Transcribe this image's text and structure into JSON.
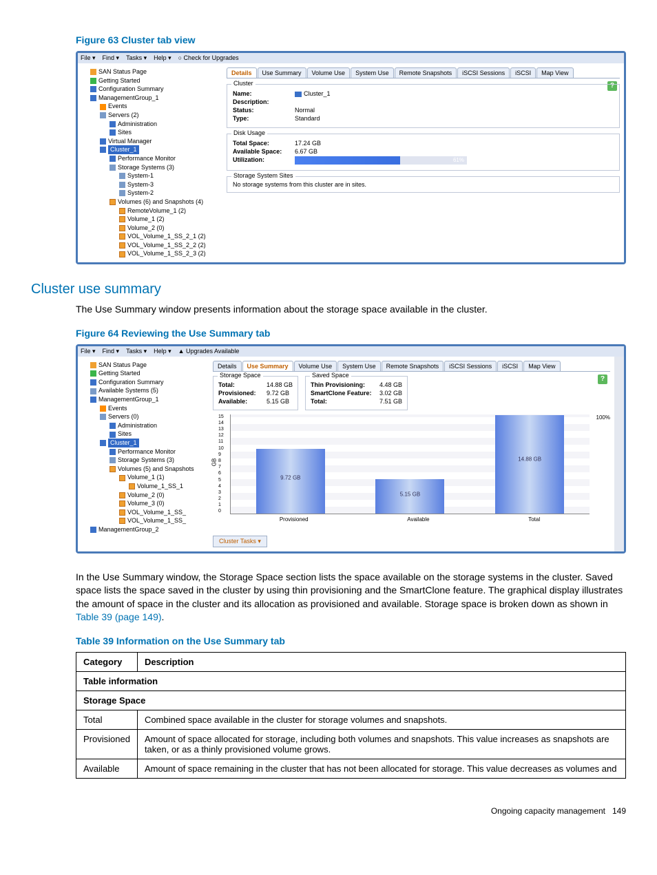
{
  "figure63": {
    "caption": "Figure 63 Cluster tab view",
    "menubar": [
      "File ▾",
      "Find ▾",
      "Tasks ▾",
      "Help ▾",
      "○ Check for Upgrades"
    ],
    "tree": [
      {
        "level": 0,
        "label": "SAN Status Page",
        "icon": "i-home"
      },
      {
        "level": 0,
        "label": "Getting Started",
        "icon": "i-green"
      },
      {
        "level": 0,
        "label": "Configuration Summary",
        "icon": "i-blue"
      },
      {
        "level": 0,
        "label": "ManagementGroup_1",
        "icon": "i-blue"
      },
      {
        "level": 1,
        "label": "Events",
        "icon": "i-orange"
      },
      {
        "level": 1,
        "label": "Servers (2)",
        "icon": "i-server"
      },
      {
        "level": 2,
        "label": "Administration",
        "icon": "i-blue"
      },
      {
        "level": 2,
        "label": "Sites",
        "icon": "i-blue"
      },
      {
        "level": 1,
        "label": "Virtual Manager",
        "icon": "i-blue"
      },
      {
        "level": 1,
        "label": "Cluster_1",
        "icon": "i-blue",
        "selected": true
      },
      {
        "level": 2,
        "label": "Performance Monitor",
        "icon": "i-blue"
      },
      {
        "level": 2,
        "label": "Storage Systems (3)",
        "icon": "i-server"
      },
      {
        "level": 3,
        "label": "System-1",
        "icon": "i-server"
      },
      {
        "level": 3,
        "label": "System-3",
        "icon": "i-server"
      },
      {
        "level": 3,
        "label": "System-2",
        "icon": "i-server"
      },
      {
        "level": 2,
        "label": "Volumes (6) and Snapshots (4)",
        "icon": "i-vol"
      },
      {
        "level": 3,
        "label": "RemoteVolume_1 (2)",
        "icon": "i-vol"
      },
      {
        "level": 3,
        "label": "Volume_1 (2)",
        "icon": "i-vol"
      },
      {
        "level": 3,
        "label": "Volume_2 (0)",
        "icon": "i-vol"
      },
      {
        "level": 3,
        "label": "VOL_Volume_1_SS_2_1 (2)",
        "icon": "i-vol"
      },
      {
        "level": 3,
        "label": "VOL_Volume_1_SS_2_2 (2)",
        "icon": "i-vol"
      },
      {
        "level": 3,
        "label": "VOL_Volume_1_SS_2_3 (2)",
        "icon": "i-vol"
      }
    ],
    "tabs": [
      "Details",
      "Use Summary",
      "Volume Use",
      "System Use",
      "Remote Snapshots",
      "iSCSI Sessions",
      "iSCSI",
      "Map View"
    ],
    "activeTab": "Details",
    "cluster": {
      "legend": "Cluster",
      "nameLabel": "Name:",
      "nameValue": "Cluster_1",
      "descLabel": "Description:",
      "descValue": "",
      "statusLabel": "Status:",
      "statusValue": "Normal",
      "typeLabel": "Type:",
      "typeValue": "Standard"
    },
    "diskUsage": {
      "legend": "Disk Usage",
      "totalLabel": "Total Space:",
      "totalValue": "17.24 GB",
      "availLabel": "Available Space:",
      "availValue": "6.67 GB",
      "utilLabel": "Utilization:",
      "utilPct": "61%"
    },
    "sites": {
      "legend": "Storage System Sites",
      "text": "No storage systems from this cluster are in sites."
    }
  },
  "section": {
    "heading": "Cluster use summary",
    "p1": "The Use Summary window presents information about the storage space available in the cluster."
  },
  "figure64": {
    "caption": "Figure 64 Reviewing the Use Summary tab",
    "menubar": [
      "File ▾",
      "Find ▾",
      "Tasks ▾",
      "Help ▾",
      "▲ Upgrades Available"
    ],
    "tree": [
      {
        "level": 0,
        "label": "SAN Status Page",
        "icon": "i-home"
      },
      {
        "level": 0,
        "label": "Getting Started",
        "icon": "i-green"
      },
      {
        "level": 0,
        "label": "Configuration Summary",
        "icon": "i-blue"
      },
      {
        "level": 0,
        "label": "Available Systems (5)",
        "icon": "i-server"
      },
      {
        "level": 0,
        "label": "ManagementGroup_1",
        "icon": "i-blue"
      },
      {
        "level": 1,
        "label": "Events",
        "icon": "i-orange"
      },
      {
        "level": 1,
        "label": "Servers (0)",
        "icon": "i-server"
      },
      {
        "level": 2,
        "label": "Administration",
        "icon": "i-blue"
      },
      {
        "level": 2,
        "label": "Sites",
        "icon": "i-blue"
      },
      {
        "level": 1,
        "label": "Cluster_1",
        "icon": "i-blue",
        "selected": true
      },
      {
        "level": 2,
        "label": "Performance Monitor",
        "icon": "i-blue"
      },
      {
        "level": 2,
        "label": "Storage Systems (3)",
        "icon": "i-server"
      },
      {
        "level": 2,
        "label": "Volumes (5) and Snapshots",
        "icon": "i-vol"
      },
      {
        "level": 3,
        "label": "Volume_1 (1)",
        "icon": "i-vol"
      },
      {
        "level": 4,
        "label": "Volume_1_SS_1",
        "icon": "i-vol"
      },
      {
        "level": 3,
        "label": "Volume_2 (0)",
        "icon": "i-vol"
      },
      {
        "level": 3,
        "label": "Volume_3 (0)",
        "icon": "i-vol"
      },
      {
        "level": 3,
        "label": "VOL_Volume_1_SS_",
        "icon": "i-vol"
      },
      {
        "level": 3,
        "label": "VOL_Volume_1_SS_",
        "icon": "i-vol"
      },
      {
        "level": 0,
        "label": "ManagementGroup_2",
        "icon": "i-blue"
      }
    ],
    "tabs": [
      "Details",
      "Use Summary",
      "Volume Use",
      "System Use",
      "Remote Snapshots",
      "iSCSI Sessions",
      "iSCSI",
      "Map View"
    ],
    "activeTab": "Use Summary",
    "storageSpace": {
      "legend": "Storage Space",
      "totalLabel": "Total:",
      "totalVal": "14.88 GB",
      "provLabel": "Provisioned:",
      "provVal": "9.72 GB",
      "availLabel": "Available:",
      "availVal": "5.15 GB"
    },
    "savedSpace": {
      "legend": "Saved Space",
      "thinLabel": "Thin Provisioning:",
      "thinVal": "4.48 GB",
      "scLabel": "SmartClone Feature:",
      "scVal": "3.02 GB",
      "totalLabel": "Total:",
      "totalVal": "7.51 GB"
    },
    "yAxisLabel": "GB",
    "pct100": "100%",
    "tasksBtn": "Cluster Tasks ▾"
  },
  "chart_data": {
    "type": "bar",
    "categories": [
      "Provisioned",
      "Available",
      "Total"
    ],
    "values": [
      9.72,
      5.15,
      14.88
    ],
    "value_labels": [
      "9.72 GB",
      "5.15 GB",
      "14.88 GB"
    ],
    "ylabel": "GB",
    "ylim": [
      0,
      15
    ],
    "yticks": [
      0,
      1,
      2,
      3,
      4,
      5,
      6,
      7,
      8,
      9,
      10,
      11,
      12,
      13,
      14,
      15
    ]
  },
  "para2": {
    "text": "In the Use Summary window, the Storage Space section lists the space available on the storage systems in the cluster. Saved space lists the space saved in the cluster by using thin provisioning and the SmartClone feature. The graphical display illustrates the amount of space in the cluster and its allocation as provisioned and available. Storage space is broken down as shown in ",
    "link": "Table 39 (page 149)",
    "tail": "."
  },
  "table39": {
    "caption": "Table 39 Information on the Use Summary tab",
    "headers": [
      "Category",
      "Description"
    ],
    "rows": [
      {
        "type": "section",
        "c": "Table information",
        "d": ""
      },
      {
        "type": "section",
        "c": "Storage Space",
        "d": ""
      },
      {
        "type": "row",
        "c": "Total",
        "d": "Combined space available in the cluster for storage volumes and snapshots."
      },
      {
        "type": "row",
        "c": "Provisioned",
        "d": "Amount of space allocated for storage, including both volumes and snapshots. This value increases as snapshots are taken, or as a thinly provisioned volume grows."
      },
      {
        "type": "row",
        "c": "Available",
        "d": "Amount of space remaining in the cluster that has not been allocated for storage. This value decreases as volumes and"
      }
    ]
  },
  "footer": {
    "text": "Ongoing capacity management",
    "page": "149"
  }
}
